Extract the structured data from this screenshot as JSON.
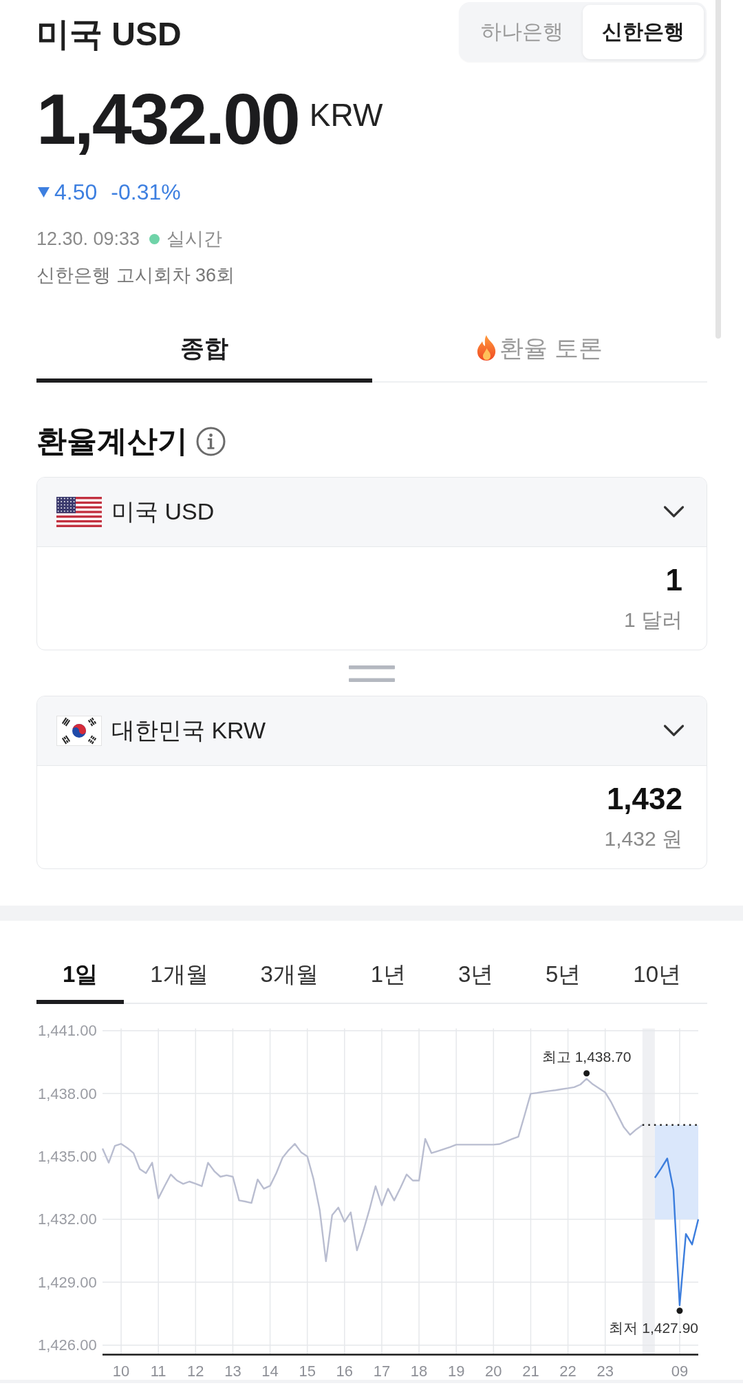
{
  "header": {
    "title": "미국 USD",
    "bank_toggle": [
      {
        "label": "하나은행",
        "selected": false
      },
      {
        "label": "신한은행",
        "selected": true
      }
    ]
  },
  "quote": {
    "price": "1,432.00",
    "unit": "KRW",
    "falling": true,
    "change": "4.50",
    "change_percent": "-0.31%",
    "timestamp": "12.30. 09:33",
    "live": true,
    "live_label": "실시간",
    "notice": "신한은행 고시회차 36회"
  },
  "tabs": [
    {
      "kind": "plain",
      "label": "종합",
      "selected": true
    },
    {
      "kind": "hot",
      "label": "환율 토론",
      "selected": false
    }
  ],
  "calculator": {
    "title": "환율계산기",
    "currencies": [
      {
        "kind": "us",
        "name": "미국 USD",
        "amount": "1",
        "amount_words": "1 달러"
      },
      {
        "kind": "kr",
        "name": "대한민국 KRW",
        "amount": "1,432",
        "amount_words": "1,432 원"
      }
    ]
  },
  "periods": [
    {
      "label": "1일",
      "selected": true
    },
    {
      "label": "1개월",
      "selected": false
    },
    {
      "label": "3개월",
      "selected": false
    },
    {
      "label": "1년",
      "selected": false
    },
    {
      "label": "3년",
      "selected": false
    },
    {
      "label": "5년",
      "selected": false
    },
    {
      "label": "10년",
      "selected": false
    }
  ],
  "chart": {
    "chart_data": {
      "type": "line",
      "grid": true,
      "categories": [
        null,
        null,
        null,
        "10",
        null,
        null,
        null,
        null,
        null,
        "11",
        null,
        null,
        null,
        null,
        null,
        "12",
        null,
        null,
        null,
        null,
        null,
        "13",
        null,
        null,
        null,
        null,
        null,
        "14",
        null,
        null,
        null,
        null,
        null,
        "15",
        null,
        null,
        null,
        null,
        null,
        "16",
        null,
        null,
        null,
        null,
        null,
        "17",
        null,
        null,
        null,
        null,
        null,
        "18",
        null,
        null,
        null,
        null,
        null,
        "19",
        null,
        null,
        null,
        null,
        null,
        "20",
        null,
        null,
        null,
        null,
        null,
        "21",
        null,
        null,
        null,
        null,
        null,
        "22",
        null,
        null,
        null,
        null,
        null,
        "23",
        null,
        null,
        null,
        null,
        null,
        null,
        null,
        null,
        null,
        null,
        null,
        "09",
        null,
        null,
        null
      ],
      "series": [
        {
          "color": "#b9bdd0",
          "values": [
            1435.38,
            1434.7,
            1435.5,
            1435.6,
            1435.4,
            1435.16,
            1434.4,
            1434.2,
            1434.7,
            1433.0,
            1433.58,
            1434.14,
            1433.85,
            1433.69,
            1433.8,
            1433.7,
            1433.58,
            1434.7,
            1434.3,
            1434.03,
            1434.1,
            1434.03,
            1432.9,
            1432.85,
            1432.78,
            1433.9,
            1433.46,
            1433.6,
            1434.2,
            1434.93,
            1435.3,
            1435.6,
            1435.2,
            1435.0,
            1433.92,
            1432.45,
            1430.0,
            1432.2,
            1432.56,
            1431.88,
            1432.33,
            1430.52,
            1431.43,
            1432.45,
            1433.58,
            1432.67,
            1433.46,
            1432.9,
            1433.5,
            1434.14,
            1433.85,
            1433.85,
            1435.84,
            1435.16,
            1435.25,
            1435.35,
            1435.45,
            1435.56,
            1435.56,
            1435.56,
            1435.56,
            1435.56,
            1435.56,
            1435.56,
            1435.59,
            1435.71,
            1435.83,
            1435.94,
            1436.95,
            1437.99,
            1438.03,
            1438.08,
            1438.12,
            1438.16,
            1438.21,
            1438.25,
            1438.3,
            1438.43,
            1438.7,
            1438.44,
            1438.25,
            1438.05,
            1437.57,
            1436.98,
            1436.39,
            1436.03,
            1436.29,
            1436.5,
            null,
            null,
            null,
            null,
            null,
            null,
            null,
            null,
            null
          ]
        },
        {
          "color": "#3b7ddd",
          "values": [
            null,
            null,
            null,
            null,
            null,
            null,
            null,
            null,
            null,
            null,
            null,
            null,
            null,
            null,
            null,
            null,
            null,
            null,
            null,
            null,
            null,
            null,
            null,
            null,
            null,
            null,
            null,
            null,
            null,
            null,
            null,
            null,
            null,
            null,
            null,
            null,
            null,
            null,
            null,
            null,
            null,
            null,
            null,
            null,
            null,
            null,
            null,
            null,
            null,
            null,
            null,
            null,
            null,
            null,
            null,
            null,
            null,
            null,
            null,
            null,
            null,
            null,
            null,
            null,
            null,
            null,
            null,
            null,
            null,
            null,
            null,
            null,
            null,
            null,
            null,
            null,
            null,
            null,
            null,
            null,
            null,
            null,
            null,
            null,
            null,
            null,
            null,
            null,
            null,
            1433.98,
            1434.42,
            1434.9,
            1433.41,
            1427.9,
            1431.3,
            1430.8,
            1432.0
          ]
        }
      ],
      "ylim": [
        1425.55,
        1441.1
      ],
      "yticks": [
        {
          "value": 1441,
          "label": "1,441.00"
        },
        {
          "value": 1438,
          "label": "1,438.00"
        },
        {
          "value": 1435,
          "label": "1,435.00"
        },
        {
          "value": 1432,
          "label": "1,432.00"
        },
        {
          "value": 1429,
          "label": "1,429.00"
        },
        {
          "value": 1426,
          "label": "1,426.00"
        }
      ],
      "ref_lines": [
        {
          "axis": "y",
          "value": 1436.5
        }
      ],
      "annotations": [
        "최고 1,438.70",
        "최저 1,427.90"
      ]
    }
  }
}
